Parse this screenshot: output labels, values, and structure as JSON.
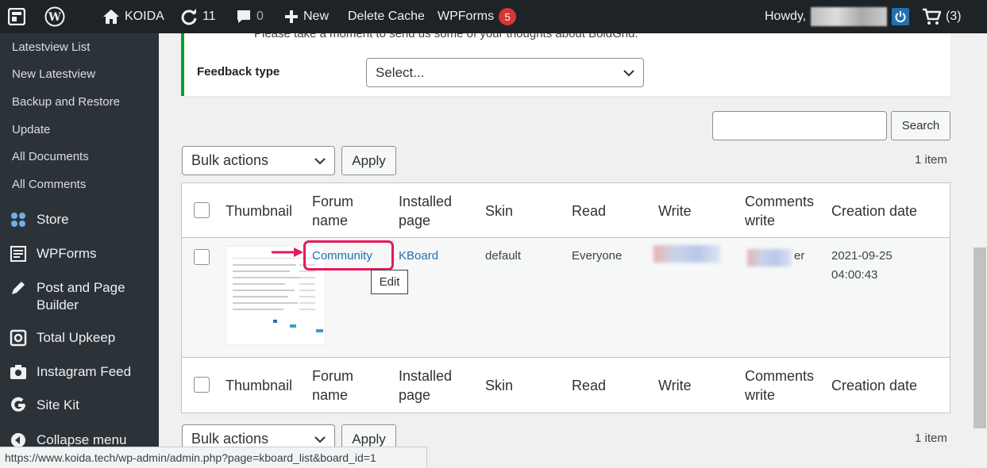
{
  "adminbar": {
    "site_name": "KOIDA",
    "updates_count": "11",
    "comments_count": "0",
    "new_label": "New",
    "delete_cache_label": "Delete Cache",
    "wpforms_label": "WPForms",
    "wpforms_badge": "5",
    "howdy_label": "Howdy,",
    "cart_count": "(3)"
  },
  "sidebar": {
    "submenu": [
      "Latestview List",
      "New Latestview",
      "Backup and Restore",
      "Update",
      "All Documents",
      "All Comments"
    ],
    "menu": {
      "store": "Store",
      "wpforms": "WPForms",
      "post_page_builder_1": "Post and Page",
      "post_page_builder_2": "Builder",
      "total_upkeep": "Total Upkeep",
      "instagram_feed": "Instagram Feed",
      "site_kit": "Site Kit",
      "collapse": "Collapse menu"
    }
  },
  "notice": {
    "text": "Please take a moment to send us some of your thoughts about BoldGrid.",
    "feedback_label": "Feedback type",
    "feedback_select": "Select..."
  },
  "search": {
    "button": "Search",
    "value": ""
  },
  "bulk": {
    "label": "Bulk actions",
    "apply": "Apply",
    "count": "1 item"
  },
  "table": {
    "headers": {
      "thumbnail": "Thumbnail",
      "forum_name_1": "Forum",
      "forum_name_2": "name",
      "installed_1": "Installed",
      "installed_2": "page",
      "skin": "Skin",
      "read": "Read",
      "write": "Write",
      "comments_1": "Comments",
      "comments_2": "write",
      "creation": "Creation date"
    },
    "row": {
      "forum_name": "Community",
      "installed_page": "KBoard",
      "skin": "default",
      "read": "Everyone",
      "comments_write_suffix": "er",
      "creation_date": "2021-09-25",
      "creation_time": "04:00:43"
    },
    "tooltip": "Edit"
  },
  "statusbar": {
    "url": "https://www.koida.tech/wp-admin/admin.php?page=kboard_list&board_id=1"
  },
  "colors": {
    "adminbar": "#1d2327",
    "sidebar": "#2c3338",
    "link": "#2271b1",
    "highlight": "#e5195f",
    "notice_border": "#00a32a"
  }
}
